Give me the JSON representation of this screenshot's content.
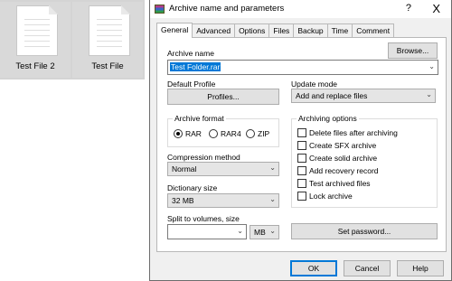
{
  "desktop": {
    "files": [
      {
        "name": "Test File 2"
      },
      {
        "name": "Test File"
      }
    ]
  },
  "dialog": {
    "title": "Archive name and parameters",
    "help_label": "?",
    "close_label": "X",
    "tabs": [
      "General",
      "Advanced",
      "Options",
      "Files",
      "Backup",
      "Time",
      "Comment"
    ],
    "archive_name_label": "Archive name",
    "browse_label": "Browse...",
    "archive_name_value": "Test Folder.rar",
    "default_profile_label": "Default Profile",
    "profiles_label": "Profiles...",
    "update_mode_label": "Update mode",
    "update_mode_value": "Add and replace files",
    "archive_format_label": "Archive format",
    "formats": [
      "RAR",
      "RAR4",
      "ZIP"
    ],
    "selected_format": "RAR",
    "archiving_options_label": "Archiving options",
    "options": [
      "Delete files after archiving",
      "Create SFX archive",
      "Create solid archive",
      "Add recovery record",
      "Test archived files",
      "Lock archive"
    ],
    "compression_label": "Compression method",
    "compression_value": "Normal",
    "dictionary_label": "Dictionary size",
    "dictionary_value": "32 MB",
    "split_label": "Split to volumes, size",
    "split_unit": "MB",
    "set_password_label": "Set password...",
    "ok_label": "OK",
    "cancel_label": "Cancel",
    "help_button_label": "Help"
  }
}
